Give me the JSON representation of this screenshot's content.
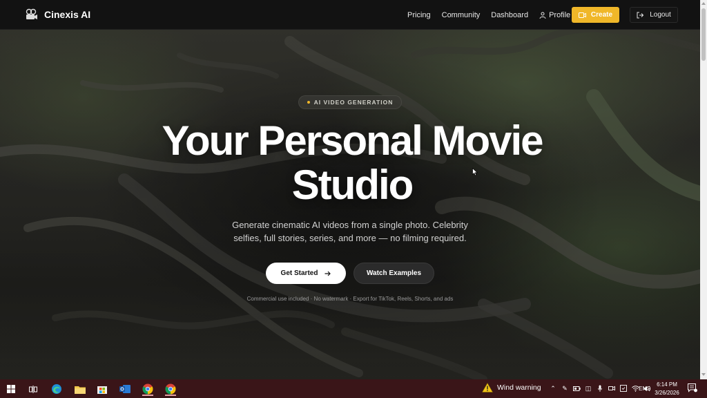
{
  "brand": {
    "name": "Cinexis AI"
  },
  "nav": {
    "links": [
      "Pricing",
      "Community",
      "Dashboard",
      "Profile"
    ],
    "create_label": "Create",
    "logout_label": "Logout"
  },
  "hero": {
    "badge": "AI VIDEO GENERATION",
    "headline_line1": "Your Personal Movie",
    "headline_line2": "Studio",
    "subtitle_line1": "Generate cinematic AI videos from a single photo. Celebrity",
    "subtitle_line2": "selfies, full stories, series, and more — no filming required.",
    "primary_cta": "Get Started",
    "secondary_cta": "Watch Examples",
    "fine_print": "Commercial use included · No watermark · Export for TikTok, Reels, Shorts, and ads"
  },
  "taskbar": {
    "weather": "Wind warning",
    "language": "ENG",
    "time": "6:14 PM",
    "date": "3/26/2026"
  },
  "colors": {
    "accent": "#f0b729",
    "navbar": "#121212",
    "taskbar": "#3a1518"
  }
}
